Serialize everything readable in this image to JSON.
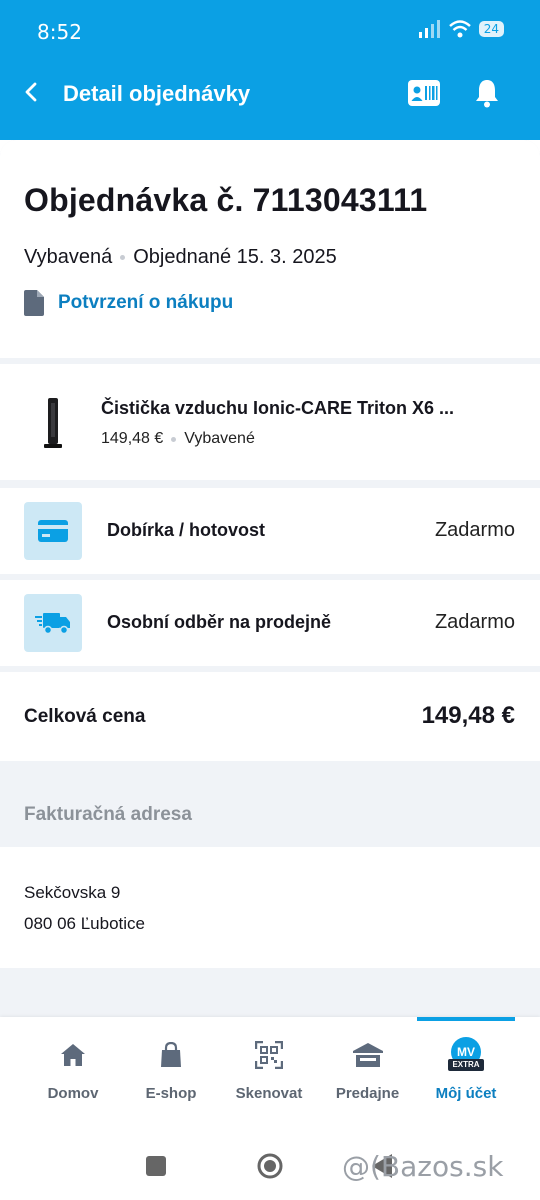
{
  "status_bar": {
    "time": "8:52",
    "battery": "24"
  },
  "app_bar": {
    "title": "Detail objednávky"
  },
  "order": {
    "title": "Objednávka č. 7113043111",
    "status": "Vybavená",
    "ordered": "Objednané 15. 3. 2025",
    "document_link": "Potvrzení o nákupu"
  },
  "item": {
    "name": "Čistička vzduchu Ionic-CARE Triton X6 ...",
    "price": "149,48 €",
    "status": "Vybavené"
  },
  "payment": {
    "label": "Dobírka / hotovost",
    "value": "Zadarmo"
  },
  "shipping": {
    "label": "Osobní odběr na prodejně",
    "value": "Zadarmo"
  },
  "total": {
    "label": "Celková cena",
    "value": "149,48 €"
  },
  "billing": {
    "heading": "Fakturačná adresa",
    "line1": "Sekčovska 9",
    "line2": "080 06 Ľubotice"
  },
  "bottom_nav": {
    "items": [
      {
        "label": "Domov"
      },
      {
        "label": "E-shop"
      },
      {
        "label": "Skenovat"
      },
      {
        "label": "Predajne"
      },
      {
        "label": "Môj účet"
      }
    ],
    "active": "Môj účet",
    "badge_text": "MV",
    "badge_sub": "EXTRA"
  },
  "watermark": "@(Bazos.sk",
  "colors": {
    "brand": "#0ba0e4",
    "link": "#0c7fc0",
    "icon_bg": "#cde8f5",
    "section_bg": "#f0f3f7"
  }
}
